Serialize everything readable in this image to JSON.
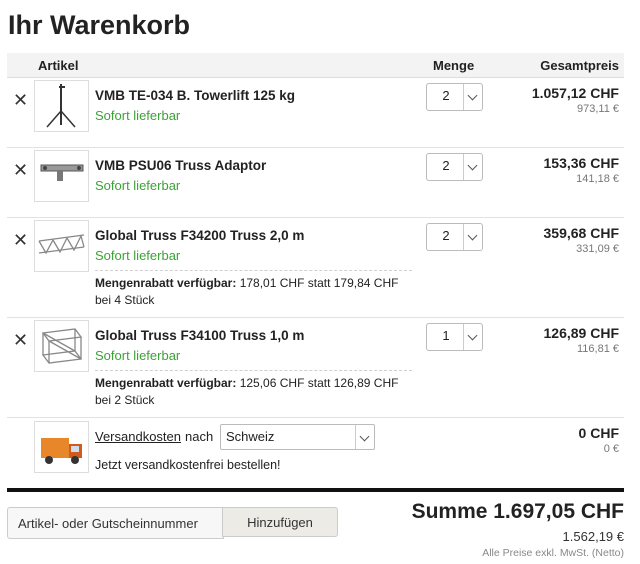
{
  "page_title": "Ihr Warenkorb",
  "table_header": {
    "artikel": "Artikel",
    "menge": "Menge",
    "gesamtpreis": "Gesamtpreis"
  },
  "remove_symbol": "✕",
  "items": [
    {
      "name": "VMB TE-034 B. Towerlift 125 kg",
      "availability": "Sofort lieferbar",
      "quantity": "2",
      "price": "1.057,12 CHF",
      "net_price": "973,11 €",
      "icon": "towerlift-icon"
    },
    {
      "name": "VMB PSU06 Truss Adaptor",
      "availability": "Sofort lieferbar",
      "quantity": "2",
      "price": "153,36 CHF",
      "net_price": "141,18 €",
      "icon": "truss-adaptor-icon"
    },
    {
      "name": "Global Truss F34200 Truss 2,0 m",
      "availability": "Sofort lieferbar",
      "quantity": "2",
      "price": "359,68 CHF",
      "net_price": "331,09 €",
      "icon": "truss-2m-icon",
      "discount_label": "Mengenrabatt verfügbar:",
      "discount_text": "178,01 CHF statt 179,84 CHF bei 4 Stück"
    },
    {
      "name": "Global Truss F34100 Truss 1,0 m",
      "availability": "Sofort lieferbar",
      "quantity": "1",
      "price": "126,89 CHF",
      "net_price": "116,81 €",
      "icon": "truss-1m-icon",
      "discount_label": "Mengenrabatt verfügbar:",
      "discount_text": "125,06 CHF statt 126,89 CHF bei 2 Stück"
    }
  ],
  "shipping": {
    "link_label": "Versandkosten",
    "nach": "nach",
    "country": "Schweiz",
    "free_note": "Jetzt versandkostenfrei bestellen!",
    "price": "0 CHF",
    "net_price": "0 €",
    "icon": "delivery-truck-icon"
  },
  "coupon": {
    "placeholder": "Artikel- oder Gutscheinnummer",
    "button_label": "Hinzufügen"
  },
  "summary": {
    "total": "Summe 1.697,05 CHF",
    "net_total": "1.562,19 €",
    "vat_note": "Alle Preise exkl. MwSt. (Netto)"
  },
  "colors": {
    "availability": "#3aa335",
    "header_bg": "#f3f3f3",
    "divider": "#111111"
  }
}
